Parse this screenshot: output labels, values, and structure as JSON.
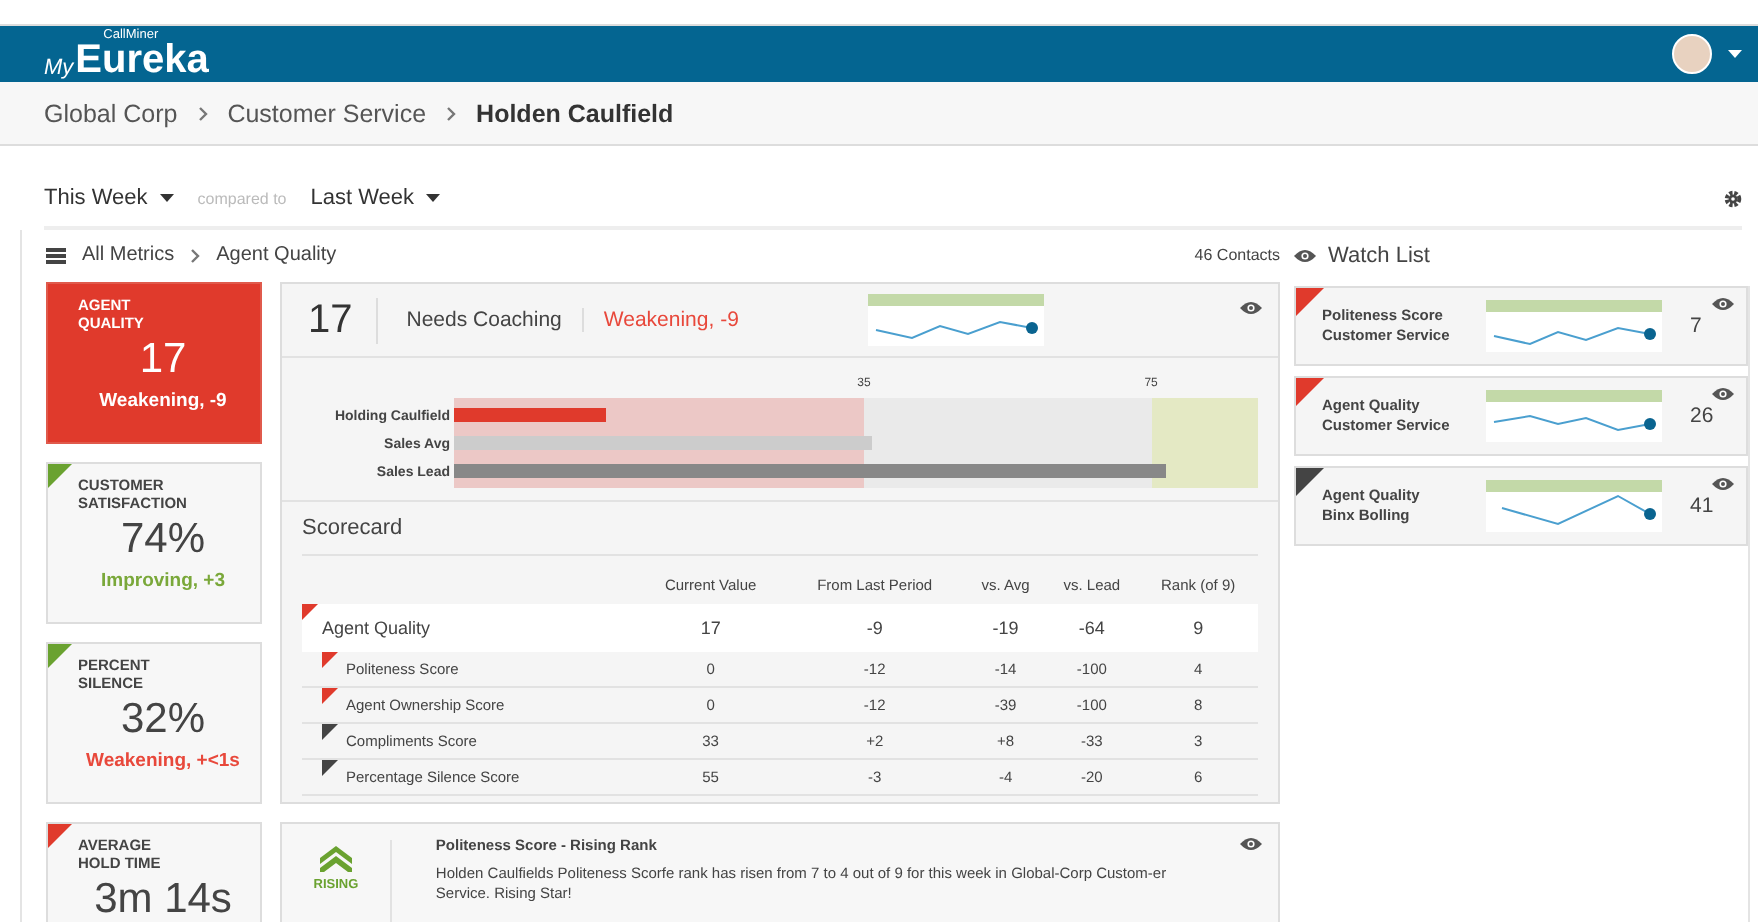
{
  "header": {
    "logo_small": "CallMiner",
    "logo_my": "My",
    "logo_main": "Eureka"
  },
  "breadcrumb": [
    {
      "label": "Global Corp",
      "current": false
    },
    {
      "label": "Customer Service",
      "current": false
    },
    {
      "label": "Holden Caulfield",
      "current": true
    }
  ],
  "period": {
    "current": "This Week",
    "compare_label": "compared to",
    "compare": "Last Week"
  },
  "metric_path": [
    "All Metrics",
    "Agent Quality"
  ],
  "contacts": "46 Contacts",
  "metric_cards": [
    {
      "title": "AGENT QUALITY",
      "value": "17",
      "trend_text": "Weakening, -9",
      "improving": false,
      "selected": true,
      "color": "#e03a2c"
    },
    {
      "title": "CUSTOMER SATISFACTION",
      "value": "74%",
      "trend_text": "Improving, +3",
      "improving": true,
      "selected": false,
      "color": "#6aa230"
    },
    {
      "title": "PERCENT SILENCE",
      "value": "32%",
      "trend_text": "Weakening, +<1s",
      "improving": false,
      "selected": false,
      "color": "#6aa230"
    },
    {
      "title": "AVERAGE HOLD TIME",
      "value": "3m 14s",
      "selected": false,
      "color": "#e03a2c"
    }
  ],
  "summary": {
    "value": "17",
    "status": "Needs Coaching",
    "trend_text": "Weakening, -9",
    "improving": false
  },
  "bullet_chart": {
    "bands": [
      {
        "label": "35",
        "level": 0.51
      },
      {
        "label": "75",
        "level": 0.867
      }
    ],
    "bars": [
      {
        "label": "Holding Caulfield",
        "kind": "agent",
        "level": 0.19
      },
      {
        "label": "Sales Avg",
        "kind": "avg",
        "level": 0.52
      },
      {
        "label": "Sales Lead",
        "kind": "lead",
        "level": 0.885
      }
    ]
  },
  "scorecard": {
    "title": "Scorecard",
    "columns": [
      "Current Value",
      "From Last Period",
      "vs. Avg",
      "vs. Lead",
      "Rank (of 9)"
    ],
    "rows": [
      {
        "kind": "summary",
        "name": "Agent Quality",
        "color": "#e03a2c",
        "cells": [
          "17",
          "-9",
          "-19",
          "-64",
          "9"
        ]
      },
      {
        "kind": "sub",
        "name": "Politeness Score",
        "color": "#e03a2c",
        "cells": [
          "0",
          "-12",
          "-14",
          "-100",
          "4"
        ]
      },
      {
        "kind": "sub",
        "name": "Agent Ownership Score",
        "color": "#e03a2c",
        "cells": [
          "0",
          "-12",
          "-39",
          "-100",
          "8"
        ]
      },
      {
        "kind": "sub",
        "name": "Compliments Score",
        "color": "#444444",
        "cells": [
          "33",
          "+2",
          "+8",
          "-33",
          "3"
        ]
      },
      {
        "kind": "sub",
        "name": "Percentage Silence Score",
        "color": "#444444",
        "cells": [
          "55",
          "-3",
          "-4",
          "-20",
          "6"
        ]
      }
    ]
  },
  "insight": {
    "badge": "RISING",
    "title": "Politeness Score - Rising Rank",
    "text": "Holden Caulfields Politeness Scorfe rank has risen from 7 to 4 out of 9 for this week in Global-Corp Custom-er Service. Rising Star!"
  },
  "watch_list": {
    "title": "Watch List",
    "items": [
      {
        "metric": "Politeness Score",
        "group": "Customer Service",
        "value": "7",
        "color": "#e03a2c"
      },
      {
        "metric": "Agent Quality",
        "group": "Customer Service",
        "value": "26",
        "color": "#e03a2c"
      },
      {
        "metric": "Agent Quality",
        "group": "Binx Bolling",
        "value": "41",
        "color": "#444444"
      }
    ]
  }
}
